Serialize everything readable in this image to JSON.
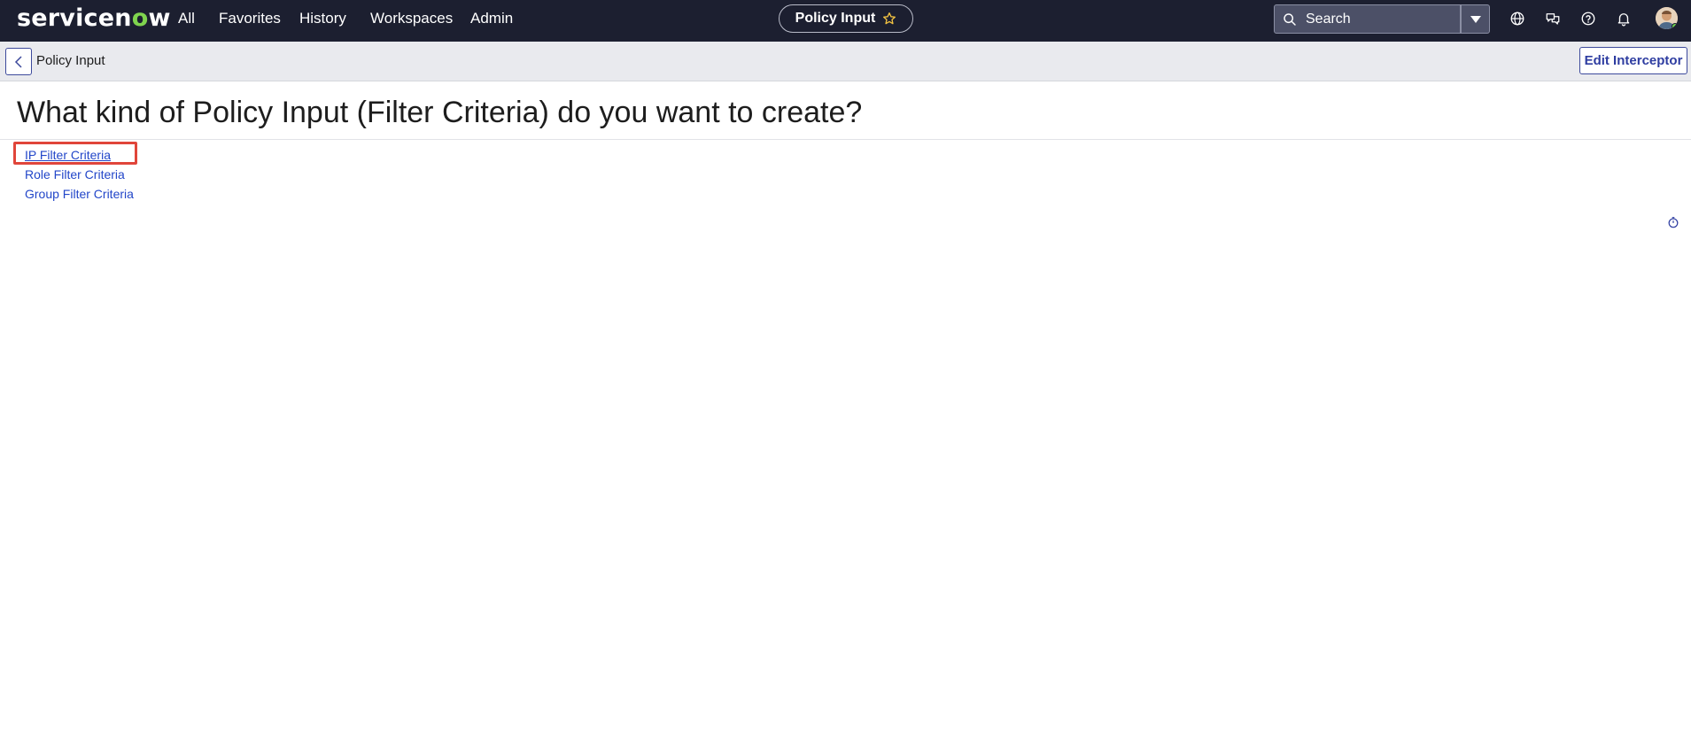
{
  "topnav": {
    "logo_pre": "servicen",
    "logo_accent": "o",
    "logo_post": "w",
    "items": [
      {
        "label": "All"
      },
      {
        "label": "Favorites"
      },
      {
        "label": "History"
      },
      {
        "label": "Workspaces"
      },
      {
        "label": "Admin"
      }
    ],
    "page_title": "Policy Input",
    "search_placeholder": "Search",
    "icons": [
      "globe-icon",
      "chat-icon",
      "help-icon",
      "bell-icon"
    ]
  },
  "subheader": {
    "title": "Policy Input",
    "edit_label": "Edit Interceptor"
  },
  "main": {
    "heading": "What kind of Policy Input (Filter Criteria) do you want to create?",
    "links": [
      {
        "label": "IP Filter Criteria"
      },
      {
        "label": "Role Filter Criteria"
      },
      {
        "label": "Group Filter Criteria"
      }
    ]
  },
  "colors": {
    "nav_bg": "#1c1f30",
    "accent_green": "#7fd44e",
    "link_blue": "#2246c9",
    "highlight_red": "#e0453a"
  }
}
